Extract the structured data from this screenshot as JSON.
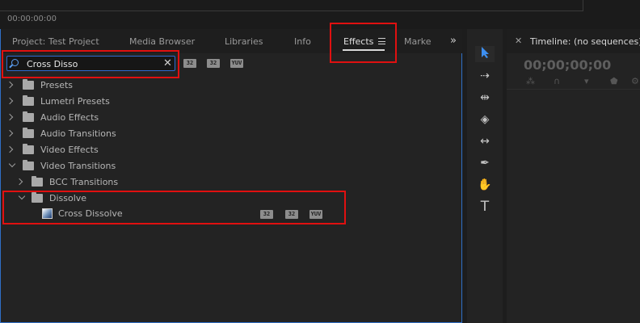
{
  "top": {
    "timecode": "00:00:00:00"
  },
  "tabs": [
    {
      "label": "Project: Test Project"
    },
    {
      "label": "Media Browser"
    },
    {
      "label": "Libraries"
    },
    {
      "label": "Info"
    },
    {
      "label": "Effects"
    },
    {
      "label": "Marke"
    }
  ],
  "overflow_label": "»",
  "search": {
    "value": "Cross Disso",
    "placeholder": ""
  },
  "filter_badges": [
    "32",
    "32",
    "YUV"
  ],
  "tree": [
    {
      "label": "Presets"
    },
    {
      "label": "Lumetri Presets"
    },
    {
      "label": "Audio Effects"
    },
    {
      "label": "Audio Transitions"
    },
    {
      "label": "Video Effects"
    },
    {
      "label": "Video Transitions"
    },
    {
      "label": "BCC Transitions"
    },
    {
      "label": "Dissolve"
    },
    {
      "label": "Cross Dissolve",
      "badges": [
        "32",
        "32",
        "YUV"
      ]
    }
  ],
  "timeline": {
    "title": "Timeline: (no sequences)",
    "timecode": "00;00;00;00"
  },
  "colors": {
    "accent": "#2f6fc6",
    "highlight": "#e01010"
  }
}
